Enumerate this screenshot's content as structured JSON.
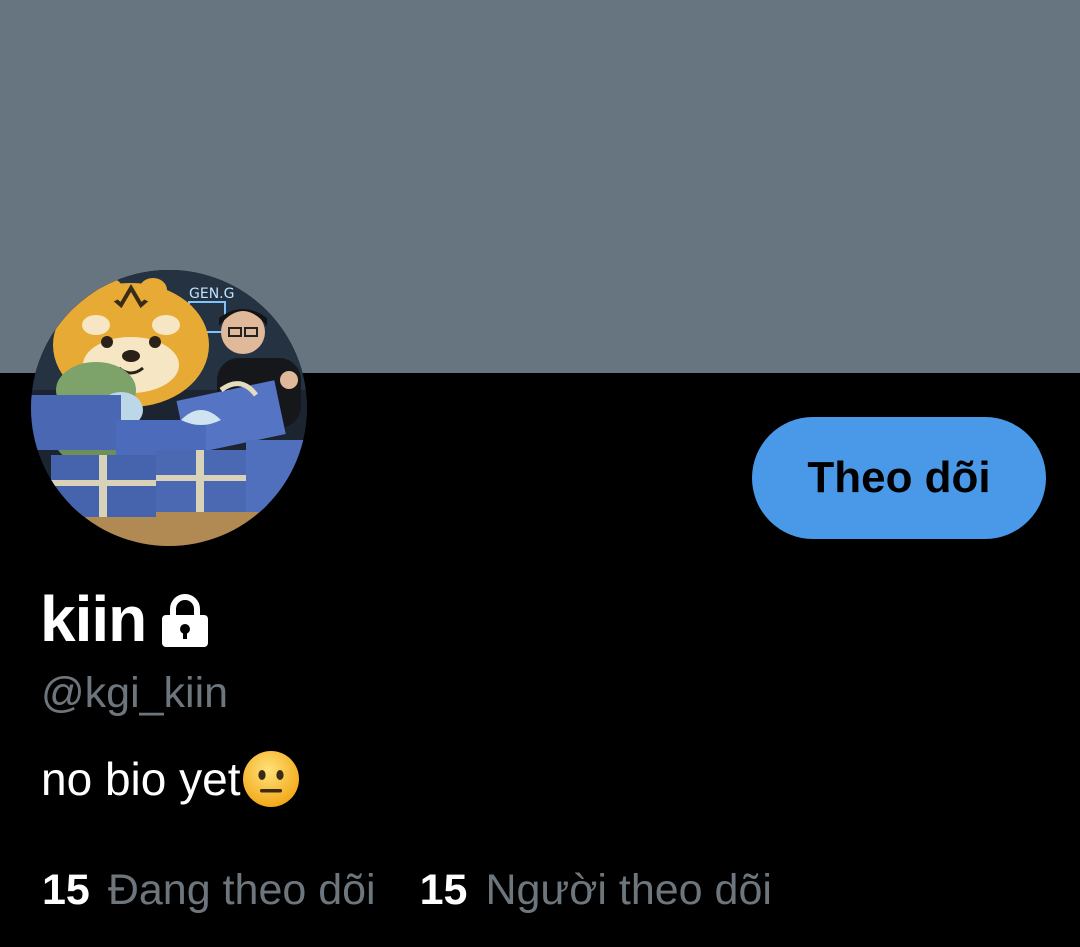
{
  "profile": {
    "display_name": "kiin",
    "handle": "@kgi_kiin",
    "bio": "no bio yet",
    "bio_emoji": "neutral-face",
    "protected_icon": "lock-icon",
    "avatar_neon_text": "GEN.G"
  },
  "actions": {
    "follow_label": "Theo dõi"
  },
  "stats": {
    "following_count": "15",
    "following_label": "Đang theo dõi",
    "followers_count": "15",
    "followers_label": "Người theo dõi"
  },
  "colors": {
    "banner": "#66757f",
    "background": "#000000",
    "follow_button": "#4a99e9",
    "secondary_text": "#6e767d"
  }
}
